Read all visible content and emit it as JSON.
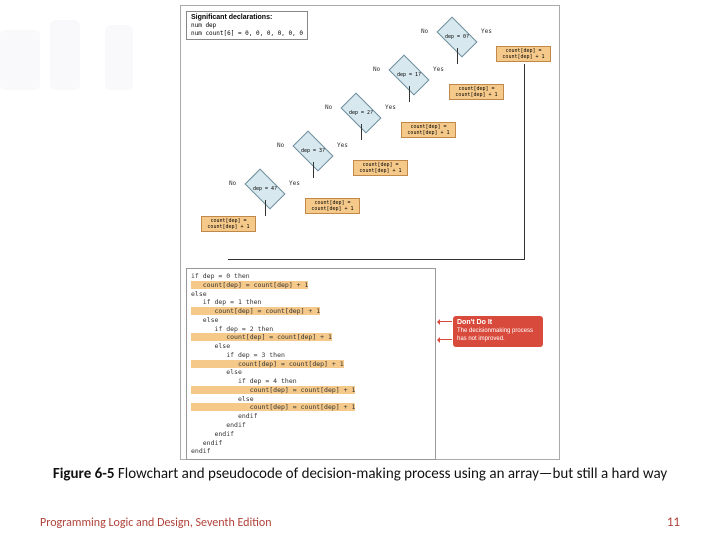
{
  "declarations": {
    "title": "Significant declarations:",
    "line1": "num dep",
    "line2": "num count[6] = 0, 0, 0, 0, 0, 0"
  },
  "decisions": [
    {
      "q": "dep = 0?",
      "no": "No",
      "yes": "Yes"
    },
    {
      "q": "dep = 1?",
      "no": "No",
      "yes": "Yes"
    },
    {
      "q": "dep = 2?",
      "no": "No",
      "yes": "Yes"
    },
    {
      "q": "dep = 3?",
      "no": "No",
      "yes": "Yes"
    },
    {
      "q": "dep = 4?",
      "no": "No",
      "yes": "Yes"
    }
  ],
  "action": "count[dep] =\ncount[dep] + 1",
  "else_action": "count[dep] =\ncount[dep] + 1",
  "pseudocode": {
    "l0": "if dep = 0 then",
    "l1": "   count[dep] = count[dep] + 1",
    "l2": "else",
    "l3": "   if dep = 1 then",
    "l4": "      count[dep] = count[dep] + 1",
    "l5": "   else",
    "l6": "      if dep = 2 then",
    "l7": "         count[dep] = count[dep] + 1",
    "l8": "      else",
    "l9": "         if dep = 3 then",
    "l10": "            count[dep] = count[dep] + 1",
    "l11": "         else",
    "l12": "            if dep = 4 then",
    "l13": "               count[dep] = count[dep] + 1",
    "l14": "            else",
    "l15": "               count[dep] = count[dep] + 1",
    "l16": "            endif",
    "l17": "         endif",
    "l18": "      endif",
    "l19": "   endif",
    "l20": "endif"
  },
  "dontbox": {
    "head": "Don't Do It",
    "body": "The decisionmaking process has not improved."
  },
  "caption_bold": "Figure 6-5",
  "caption_rest": " Flowchart and pseudocode of decision-making process using an array—but still a hard way",
  "footer_left": "Programming Logic and Design, Seventh Edition",
  "footer_right": "11"
}
